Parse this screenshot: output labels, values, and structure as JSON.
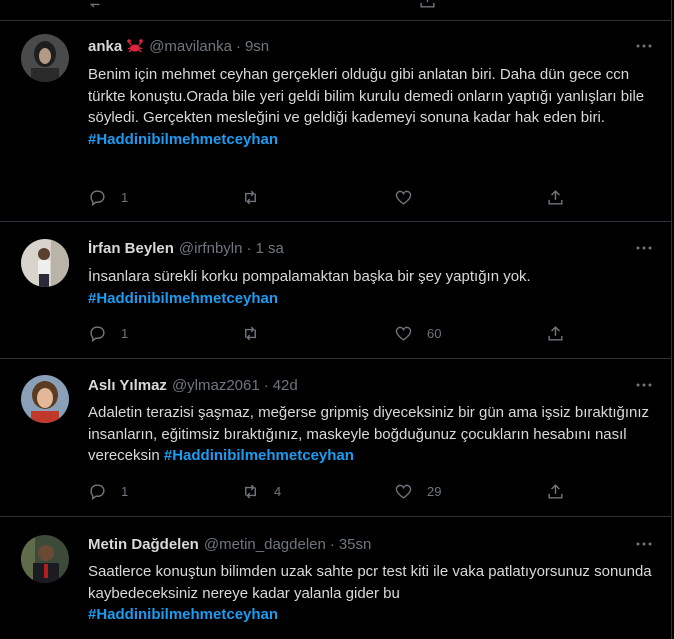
{
  "colors": {
    "background": "#000000",
    "text": "#d9d9d9",
    "secondary": "#6e767d",
    "accent": "#1d9bf0",
    "divider": "#2f3336"
  },
  "tweets": [
    {
      "name": "anka",
      "emoji": "crab-emoji-icon",
      "handle": "@mavilanka",
      "time": "9sn",
      "text": "Benim için mehmet ceyhan gerçekleri olduğu gibi anlatan biri. Daha dün gece ccn türkte konuştu.Orada bile yeri geldi bilim kurulu demedi onların yaptığı yanlışları bile söyledi. Gerçekten mesleğini ve geldiği kademeyi sonuna kadar hak eden biri.",
      "hashtag": "#Haddinibilmehmetceyhan",
      "replies": "1",
      "retweets": "",
      "likes": ""
    },
    {
      "name": "İrfan Beylen",
      "handle": "@irfnbyln",
      "time": "1 sa",
      "text": "İnsanlara sürekli korku pompalamaktan başka bir şey yaptığın yok.",
      "hashtag": "#Haddinibilmehmetceyhan",
      "replies": "1",
      "retweets": "",
      "likes": "60"
    },
    {
      "name": "Aslı Yılmaz",
      "handle": "@ylmaz2061",
      "time": "42d",
      "text": "Adaletin terazisi şaşmaz, meğerse gripmiş diyeceksiniz bir gün ama işsiz bıraktığınız insanların, eğitimsiz bıraktığınız, maskeyle boğduğunuz çocukların hesabını nasıl vereceksin",
      "hashtag": "#Haddinibilmehmetceyhan",
      "replies": "1",
      "retweets": "4",
      "likes": "29"
    },
    {
      "name": "Metin Dağdelen",
      "handle": "@metin_dagdelen",
      "time": "35sn",
      "text": "Saatlerce konuştun bilimden uzak sahte pcr test kiti ile vaka patlatıyorsunuz sonunda kaybedeceksiniz nereye kadar yalanla gider bu",
      "hashtag": "#Haddinibilmehmetceyhan"
    }
  ]
}
